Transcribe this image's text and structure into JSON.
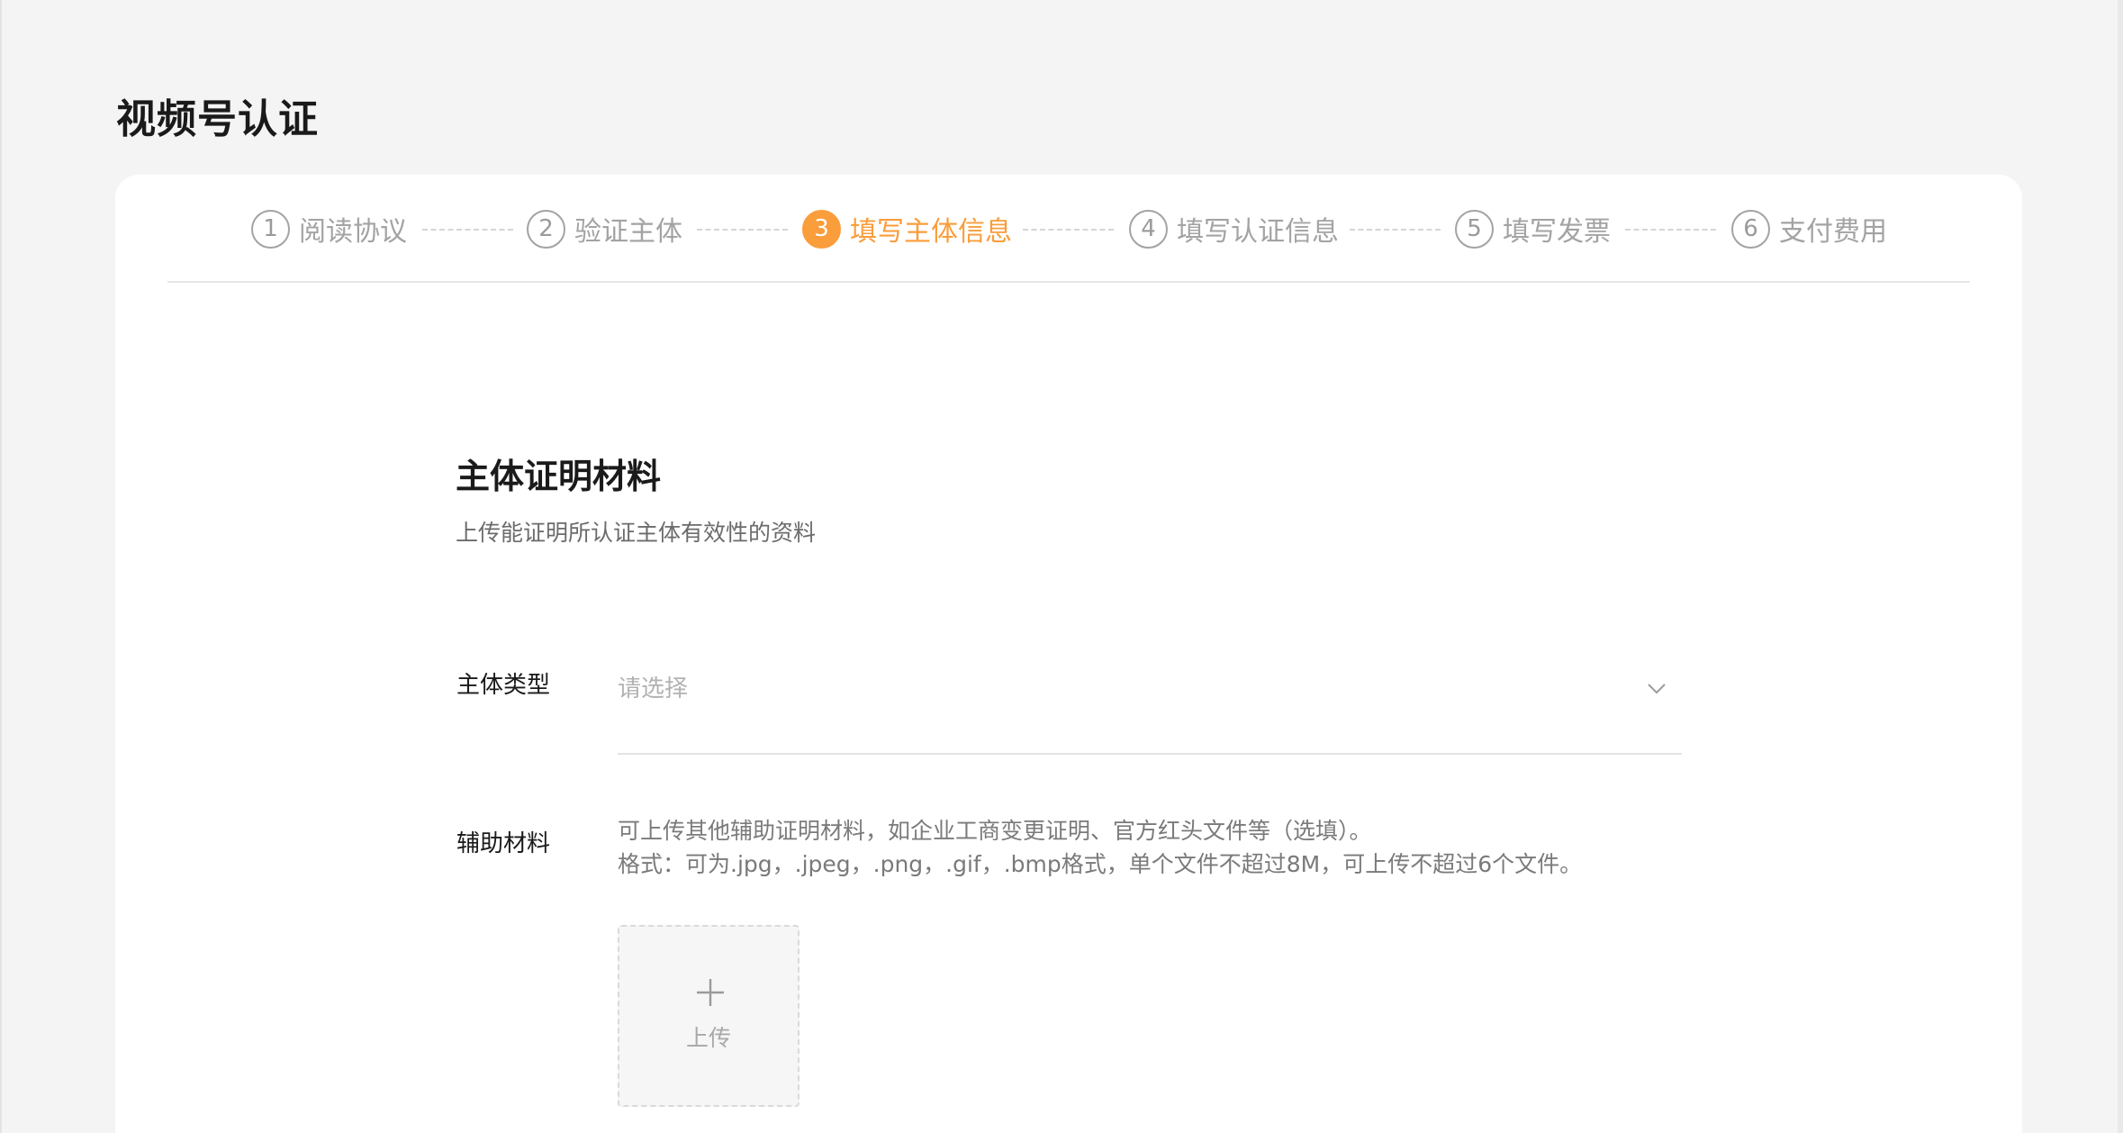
{
  "page": {
    "title": "视频号认证"
  },
  "steps": [
    {
      "num": "1",
      "label": "阅读协议",
      "active": false
    },
    {
      "num": "2",
      "label": "验证主体",
      "active": false
    },
    {
      "num": "3",
      "label": "填写主体信息",
      "active": true
    },
    {
      "num": "4",
      "label": "填写认证信息",
      "active": false
    },
    {
      "num": "5",
      "label": "填写发票",
      "active": false
    },
    {
      "num": "6",
      "label": "支付费用",
      "active": false
    }
  ],
  "section": {
    "title": "主体证明材料",
    "description": "上传能证明所认证主体有效性的资料"
  },
  "form": {
    "entity_type": {
      "label": "主体类型",
      "placeholder": "请选择",
      "icon": "chevron-down-icon"
    },
    "aux_material": {
      "label": "辅助材料",
      "hint_line1": "可上传其他辅助证明材料，如企业工商变更证明、官方红头文件等（选填）。",
      "hint_line2": "格式：可为.jpg，.jpeg，.png，.gif，.bmp格式，单个文件不超过8M，可上传不超过6个文件。",
      "upload_label": "上传",
      "upload_icon": "plus-icon"
    }
  },
  "colors": {
    "accent": "#fa9d3b",
    "background": "#f4f4f4",
    "card": "#ffffff"
  }
}
